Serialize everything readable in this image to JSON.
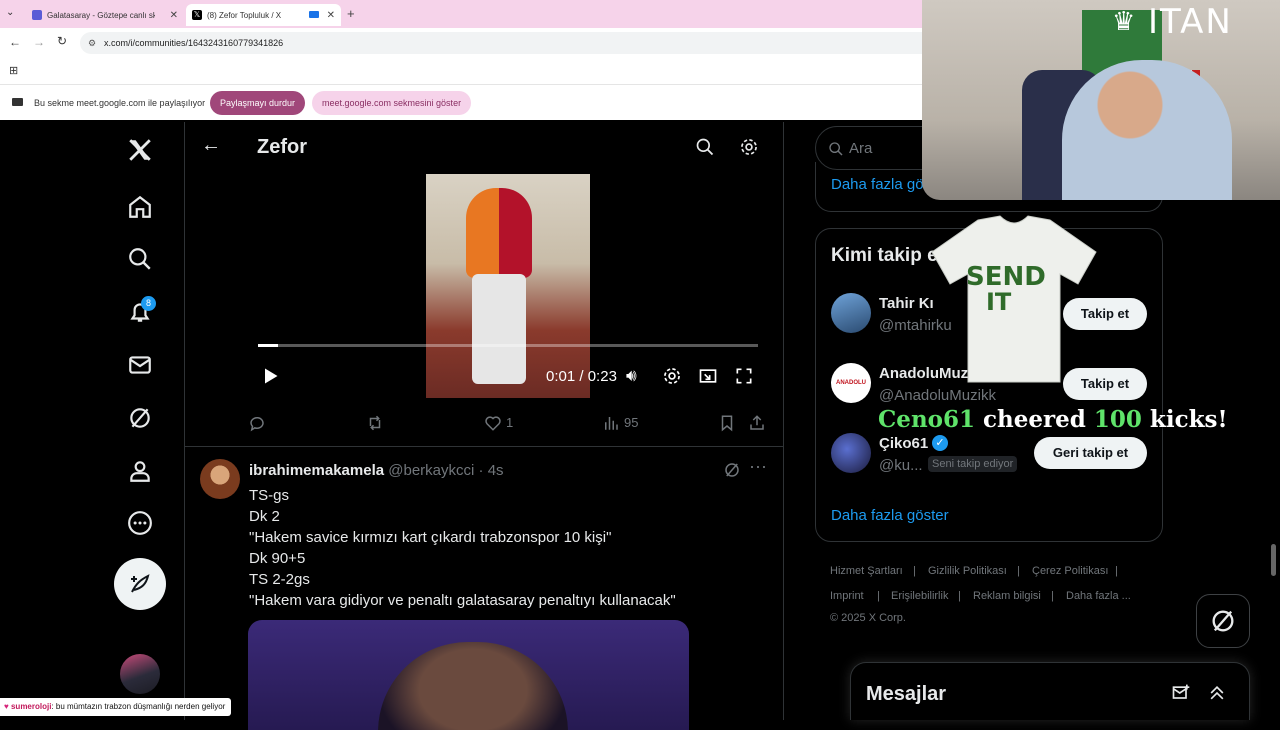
{
  "browser": {
    "tabs": [
      {
        "title": "Galatasaray - Göztepe canlı skor"
      },
      {
        "title": "(8) Zefor Topluluk / X"
      }
    ],
    "url": "x.com/i/communities/1643243160779341826",
    "share": {
      "message": "Bu sekme meet.google.com ile paylaşılıyor",
      "stop_label": "Paylaşmayı durdur",
      "show_label": "meet.google.com sekmesini göster"
    }
  },
  "nav": {
    "notification_count": "8"
  },
  "header": {
    "title": "Zefor"
  },
  "video": {
    "time_current": "0:01",
    "time_separator": "/",
    "time_total": "0:23",
    "progress": 0.04
  },
  "tweet1_actions": {
    "likes": "1",
    "views": "95"
  },
  "tweet2": {
    "display_name": "ibrahimemakamela",
    "handle": "@berkaykcci",
    "dot": "·",
    "time": "4s",
    "lines": [
      "TS-gs",
      "Dk 2",
      "\"Hakem savice kırmızı kart çıkardı trabzonspor 10 kişi\"",
      "Dk 90+5",
      "TS 2-2gs",
      "\"Hakem vara gidiyor ve penaltı galatasaray penaltıyı kullanacak\""
    ]
  },
  "sidebar": {
    "search_placeholder": "Ara",
    "more_top": "Daha fazla göster",
    "who_to_follow_title": "Kimi takip et",
    "accounts": [
      {
        "name": "Tahir Kı",
        "handle": "@mtahirku",
        "button": "Takip et"
      },
      {
        "name": "AnadoluMuz",
        "handle": "@AnadoluMuzikk",
        "button": "Takip et"
      },
      {
        "name": "Çiko61",
        "handle": "@ku...",
        "follows_you": "Seni takip ediyor",
        "button": "Geri takip et"
      }
    ],
    "more_bottom": "Daha fazla göster",
    "footer_links": [
      "Hizmet Şartları",
      "Gizlilik Politikası",
      "Çerez Politikası",
      "Imprint",
      "Erişilebilirlik",
      "Reklam bilgisi",
      "Daha fazla ..."
    ],
    "copyright": "© 2025 X Corp.",
    "messages_title": "Mesajlar"
  },
  "overlay": {
    "brand": "ITAN",
    "shirt_text_1": "SEND",
    "shirt_text_2": "IT",
    "cheer_user": "Ceno61",
    "cheer_word": "cheered",
    "cheer_count": "100",
    "cheer_suffix": "kicks!",
    "chat_user": "sumeroloji",
    "chat_message": ": bu mümtazın trabzon düşmanlığı nerden geliyor"
  },
  "colors": {
    "accent": "#1d9bf0",
    "share_purple": "#a0477a",
    "tab_pink": "#f6d3ea"
  }
}
